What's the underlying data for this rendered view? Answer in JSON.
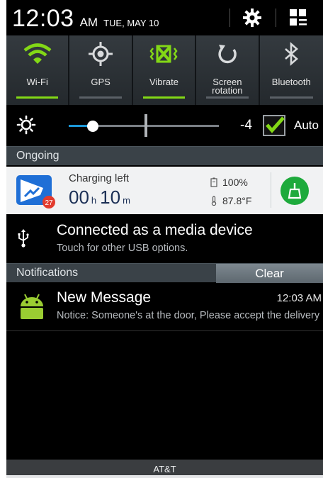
{
  "status": {
    "time": "12:03",
    "ampm": "AM",
    "date": "TUE, MAY 10",
    "icons": {
      "settings": "gear-icon",
      "edit": "edit-toggles-icon"
    }
  },
  "quick_toggles": [
    {
      "label": "Wi-Fi",
      "on": true,
      "icon": "wifi-icon"
    },
    {
      "label": "GPS",
      "on": false,
      "icon": "gps-icon"
    },
    {
      "label": "Vibrate",
      "on": true,
      "icon": "vibrate-icon"
    },
    {
      "label": "Screen rotation",
      "on": false,
      "icon": "rotation-icon"
    },
    {
      "label": "Bluetooth",
      "on": false,
      "icon": "bluetooth-icon"
    }
  ],
  "brightness": {
    "value": "-4",
    "level_fraction": 0.16,
    "auto_checked": true,
    "auto_label": "Auto",
    "icon": "brightness-icon"
  },
  "ongoing": {
    "header": "Ongoing",
    "battery": {
      "title": "Charging left",
      "hours": "00",
      "hours_unit": "h",
      "minutes": "10",
      "minutes_unit": "m",
      "percent": "100%",
      "temperature": "87.8°F",
      "badge": "27"
    },
    "usb": {
      "title": "Connected as a media device",
      "subtitle": "Touch for other USB options."
    }
  },
  "notifications": {
    "header": "Notifications",
    "clear_label": "Clear",
    "items": [
      {
        "title": "New Message",
        "time": "12:03 AM",
        "body": "Notice: Someone's at the door, Please accept the delivery"
      }
    ]
  },
  "carrier": "AT&T",
  "colors": {
    "accent_green": "#83d816",
    "slider_blue": "#1c98d8",
    "boost_green": "#1eaa3c",
    "android_green": "#9acd32"
  }
}
